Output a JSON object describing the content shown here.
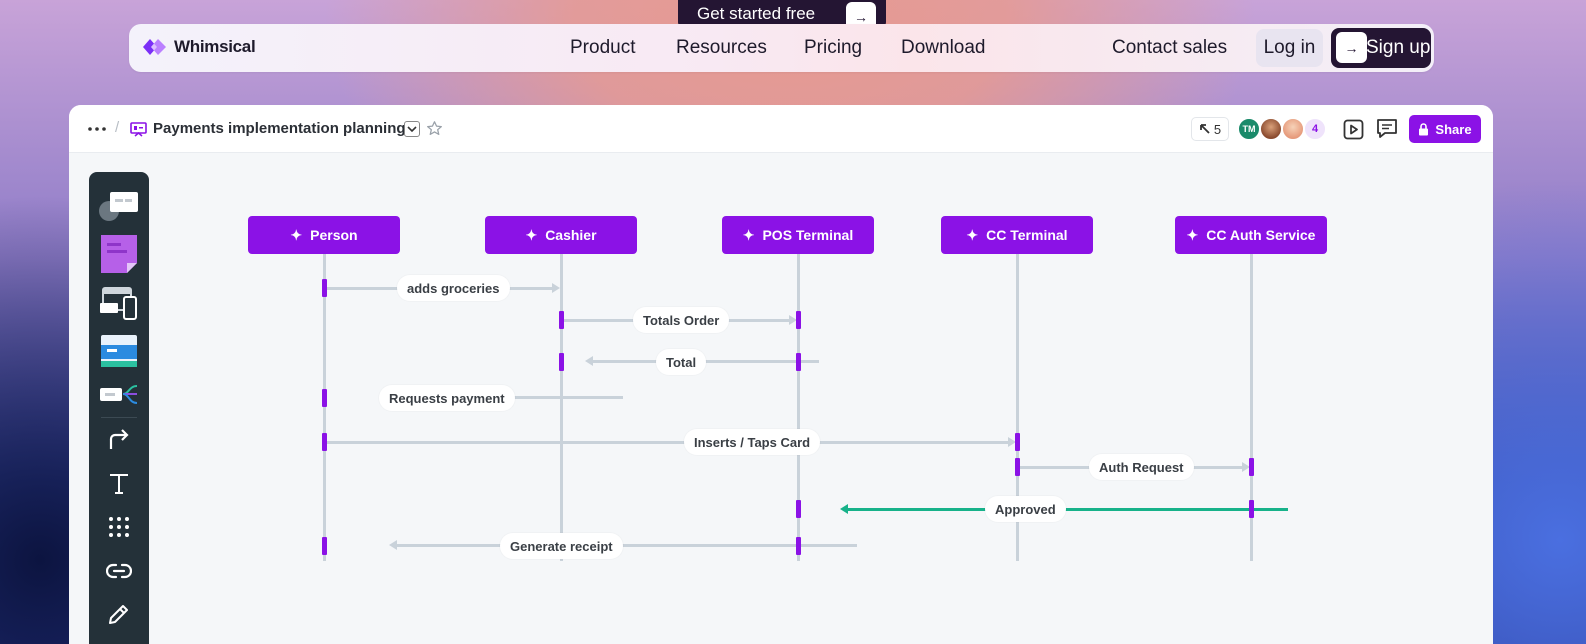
{
  "top_cta": {
    "label": "Get started free",
    "icon": "arrow-right-icon"
  },
  "nav": {
    "brand": "Whimsical",
    "links": [
      "Product",
      "Resources",
      "Pricing",
      "Download"
    ],
    "contact": "Contact sales",
    "login": "Log in",
    "signup": "Sign up"
  },
  "app": {
    "breadcrumb_sep": "/",
    "doc_title": "Payments implementation planning",
    "pointer_count": "5",
    "avatars": [
      {
        "initials": "TM",
        "color": "#1a8a6a"
      },
      {
        "initials": "",
        "color": "#a0593a"
      },
      {
        "initials": "",
        "color": "#e7a58d"
      }
    ],
    "extra_count": "4",
    "share": "Share"
  },
  "toolbar": {
    "tools": [
      "sticky-comment-icon",
      "sticky-note-icon",
      "wireframe-icon",
      "card-icon",
      "mindmap-icon",
      "connector-icon",
      "text-icon",
      "grid-icon",
      "link-icon",
      "pencil-icon"
    ]
  },
  "diagram": {
    "actors": [
      "Person",
      "Cashier",
      "POS Terminal",
      "CC Terminal",
      "CC Auth Service"
    ],
    "messages": [
      {
        "label": "adds groceries"
      },
      {
        "label": "Totals Order"
      },
      {
        "label": "Total"
      },
      {
        "label": "Requests payment"
      },
      {
        "label": "Inserts / Taps Card"
      },
      {
        "label": "Auth Request"
      },
      {
        "label": "Approved"
      },
      {
        "label": "Generate receipt"
      }
    ]
  },
  "colors": {
    "accent": "#8b12e6",
    "approved": "#17b28a",
    "dark": "#241533"
  }
}
